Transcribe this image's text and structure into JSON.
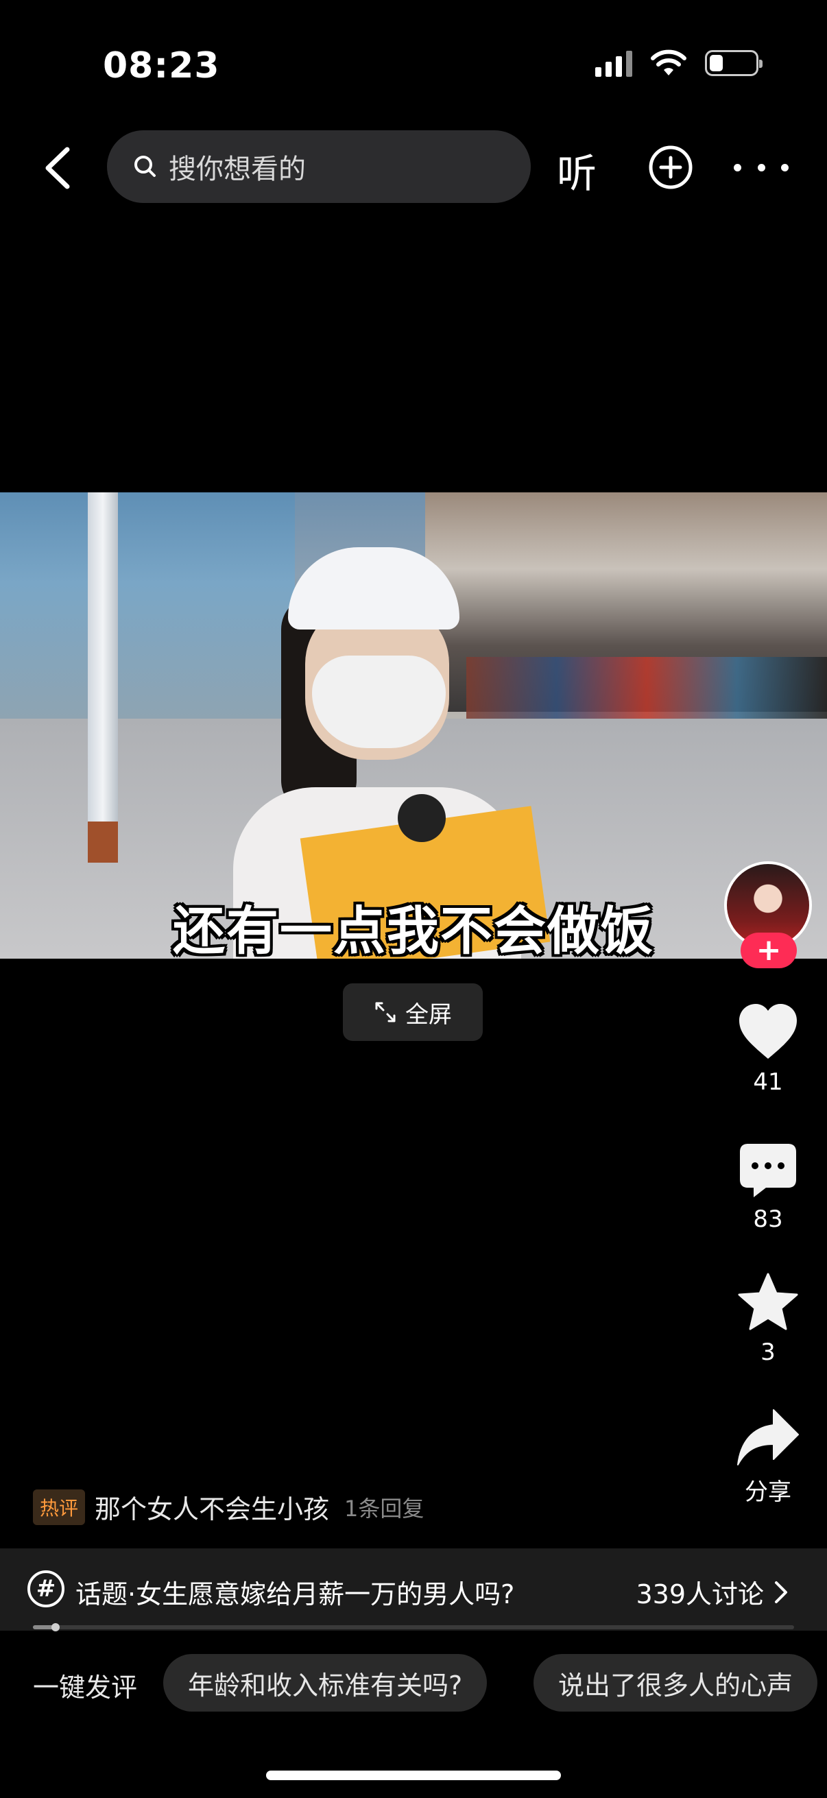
{
  "status_bar": {
    "time": "08:23",
    "battery_level": 0.3
  },
  "top_nav": {
    "search_placeholder": "搜你想看的",
    "listen_label": "听"
  },
  "video": {
    "subtitle": "还有一点我不会做饭"
  },
  "fullscreen": {
    "label": "全屏"
  },
  "actions": {
    "like_count": "41",
    "comment_count": "83",
    "favorite_count": "3",
    "share_label": "分享"
  },
  "hot_comment": {
    "badge": "热评",
    "text": "那个女人不会生小孩",
    "replies": "1条回复"
  },
  "topic": {
    "icon": "#",
    "text": "话题·女生愿意嫁给月薪一万的男人吗?",
    "count": "339人讨论"
  },
  "playback_progress": 0.03,
  "quick_comment": {
    "label": "一键发评",
    "chips": [
      "年龄和收入标准有关吗?",
      "说出了很多人的心声"
    ]
  },
  "colors": {
    "accent": "#fe2c55",
    "hot_badge": "#ff9a3c"
  }
}
